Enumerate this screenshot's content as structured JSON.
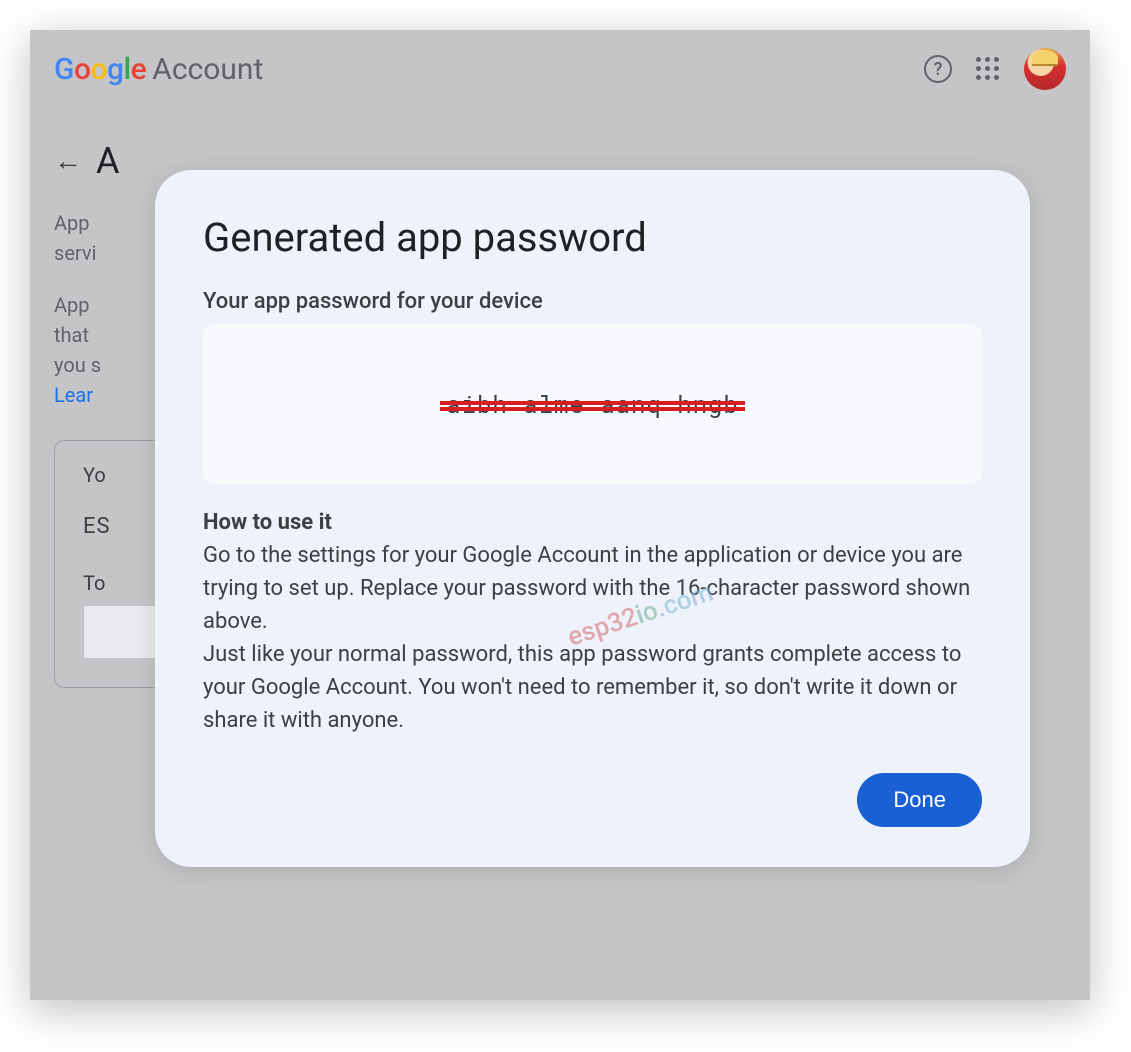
{
  "header": {
    "logo_google": "Google",
    "account_label": "Account",
    "help_glyph": "?"
  },
  "page": {
    "title_partial": "A",
    "p1": "App",
    "p1b": "servi",
    "p2": "App",
    "p2b": "that",
    "p2c": "you s",
    "learn": "Lear",
    "card_head": "Yo",
    "row_label": "ES",
    "card_sub": "To"
  },
  "modal": {
    "title": "Generated app password",
    "subtitle": "Your app password for your device",
    "password_redacted": "aibh alme aanq hngb",
    "howto_head": "How to use it",
    "howto_p1": "Go to the settings for your Google Account in the application or device you are trying to set up. Replace your password with the 16-character password shown above.",
    "howto_p2": "Just like your normal password, this app password grants complete access to your Google Account. You won't need to remember it, so don't write it down or share it with anyone.",
    "done_label": "Done"
  },
  "watermark": {
    "a": "esp32",
    "b": "io",
    "c": ".com"
  }
}
